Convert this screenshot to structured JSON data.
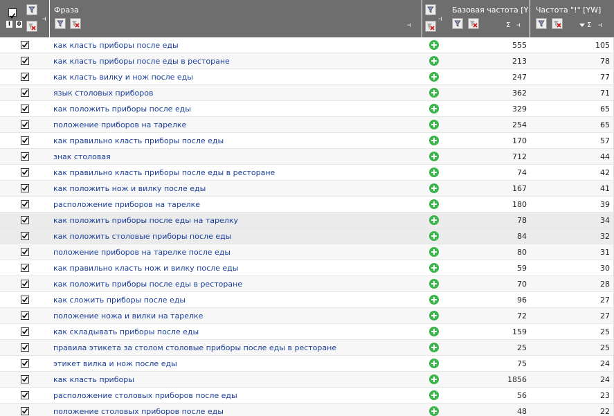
{
  "columns": {
    "phrase": "Фраза",
    "base": "Базовая частота [Y",
    "exclam": "Частота \"!\" [YW]",
    "sum_symbol": "Σ",
    "pin_symbol": "⊣",
    "toggle_i": "I",
    "toggle_0": "0"
  },
  "colors": {
    "header_bg": "#6e6e6e",
    "link_text": "#1a3e9a",
    "add_icon": "#3ab54a"
  },
  "rows": [
    {
      "phrase": "как класть приборы после еды",
      "base": "555",
      "exclam": "105"
    },
    {
      "phrase": "как класть приборы после еды в ресторане",
      "base": "213",
      "exclam": "78"
    },
    {
      "phrase": "как класть вилку и нож после еды",
      "base": "247",
      "exclam": "77"
    },
    {
      "phrase": "язык столовых приборов",
      "base": "362",
      "exclam": "71"
    },
    {
      "phrase": "как положить приборы после еды",
      "base": "329",
      "exclam": "65"
    },
    {
      "phrase": "положение приборов на тарелке",
      "base": "254",
      "exclam": "65"
    },
    {
      "phrase": "как правильно класть приборы после еды",
      "base": "170",
      "exclam": "57"
    },
    {
      "phrase": "знак столовая",
      "base": "712",
      "exclam": "44"
    },
    {
      "phrase": "как правильно класть приборы после еды в ресторане",
      "base": "74",
      "exclam": "42"
    },
    {
      "phrase": "как положить нож и вилку после еды",
      "base": "167",
      "exclam": "41"
    },
    {
      "phrase": "расположение приборов на тарелке",
      "base": "180",
      "exclam": "39"
    },
    {
      "phrase": "как положить приборы после еды на тарелку",
      "base": "78",
      "exclam": "34"
    },
    {
      "phrase": "как положить столовые приборы после еды",
      "base": "84",
      "exclam": "32"
    },
    {
      "phrase": "положение приборов на тарелке после еды",
      "base": "80",
      "exclam": "31"
    },
    {
      "phrase": "как правильно класть нож и вилку после еды",
      "base": "59",
      "exclam": "30"
    },
    {
      "phrase": "как положить приборы после еды в ресторане",
      "base": "70",
      "exclam": "28"
    },
    {
      "phrase": "как сложить приборы после еды",
      "base": "96",
      "exclam": "27"
    },
    {
      "phrase": "положение ножа и вилки на тарелке",
      "base": "72",
      "exclam": "27"
    },
    {
      "phrase": "как складывать приборы после еды",
      "base": "159",
      "exclam": "25"
    },
    {
      "phrase": "правила этикета за столом столовые приборы после еды в ресторане",
      "base": "25",
      "exclam": "25"
    },
    {
      "phrase": "этикет вилка и нож после еды",
      "base": "75",
      "exclam": "24"
    },
    {
      "phrase": "как класть приборы",
      "base": "1856",
      "exclam": "24"
    },
    {
      "phrase": "расположение столовых приборов после еды",
      "base": "56",
      "exclam": "23"
    },
    {
      "phrase": "положение столовых приборов после еды",
      "base": "48",
      "exclam": "22"
    }
  ]
}
